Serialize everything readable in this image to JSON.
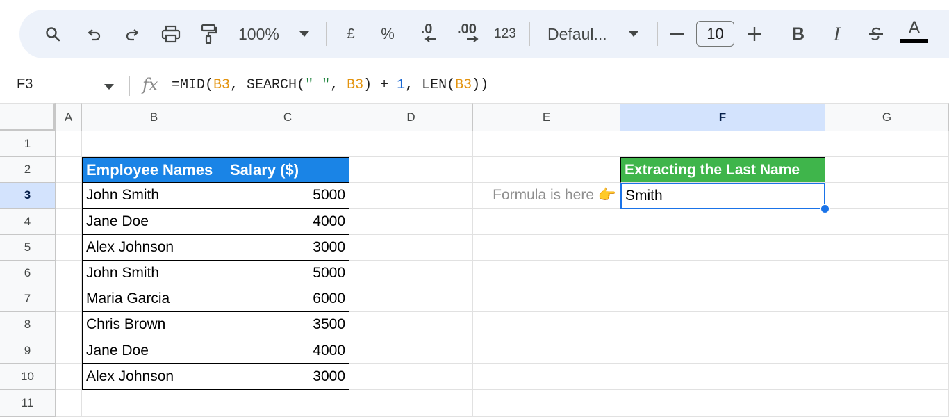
{
  "toolbar": {
    "zoom": "100%",
    "currency_label": "£",
    "percent_label": "%",
    "decrease_decimal_label": ".0",
    "increase_decimal_label": ".00",
    "number_format_label": "123",
    "font_name": "Defaul...",
    "font_size": "10",
    "bold_label": "B",
    "italic_label": "I",
    "text_color_label": "A"
  },
  "formula_bar": {
    "name_box": "F3",
    "fx": "fx",
    "formula_tokens": [
      {
        "t": "=MID(",
        "k": "plain"
      },
      {
        "t": "B3",
        "k": "ref"
      },
      {
        "t": ", SEARCH(",
        "k": "plain"
      },
      {
        "t": "\" \"",
        "k": "str"
      },
      {
        "t": ", ",
        "k": "plain"
      },
      {
        "t": "B3",
        "k": "ref"
      },
      {
        "t": ") + ",
        "k": "plain"
      },
      {
        "t": "1",
        "k": "num"
      },
      {
        "t": ", LEN(",
        "k": "plain"
      },
      {
        "t": "B3",
        "k": "ref"
      },
      {
        "t": "))",
        "k": "plain"
      }
    ]
  },
  "columns": [
    "A",
    "B",
    "C",
    "D",
    "E",
    "F",
    "G"
  ],
  "selected_column": "F",
  "rows": [
    "1",
    "2",
    "3",
    "4",
    "5",
    "6",
    "7",
    "8",
    "9",
    "10",
    "11"
  ],
  "selected_row": "3",
  "table": {
    "headers": [
      "Employee Names",
      "Salary ($)"
    ],
    "rows": [
      [
        "John Smith",
        "5000"
      ],
      [
        "Jane Doe",
        "4000"
      ],
      [
        "Alex Johnson",
        "3000"
      ],
      [
        "John Smith",
        "5000"
      ],
      [
        "Maria Garcia",
        "6000"
      ],
      [
        "Chris Brown",
        "3500"
      ],
      [
        "Jane Doe",
        "4000"
      ],
      [
        "Alex Johnson",
        "3000"
      ]
    ]
  },
  "result": {
    "header": "Extracting the Last Name",
    "value": "Smith",
    "note": "Formula is here 👉"
  },
  "colors": {
    "blue_header": "#1a84e6",
    "green_header": "#3fb54b",
    "selection": "#1a73e8"
  }
}
